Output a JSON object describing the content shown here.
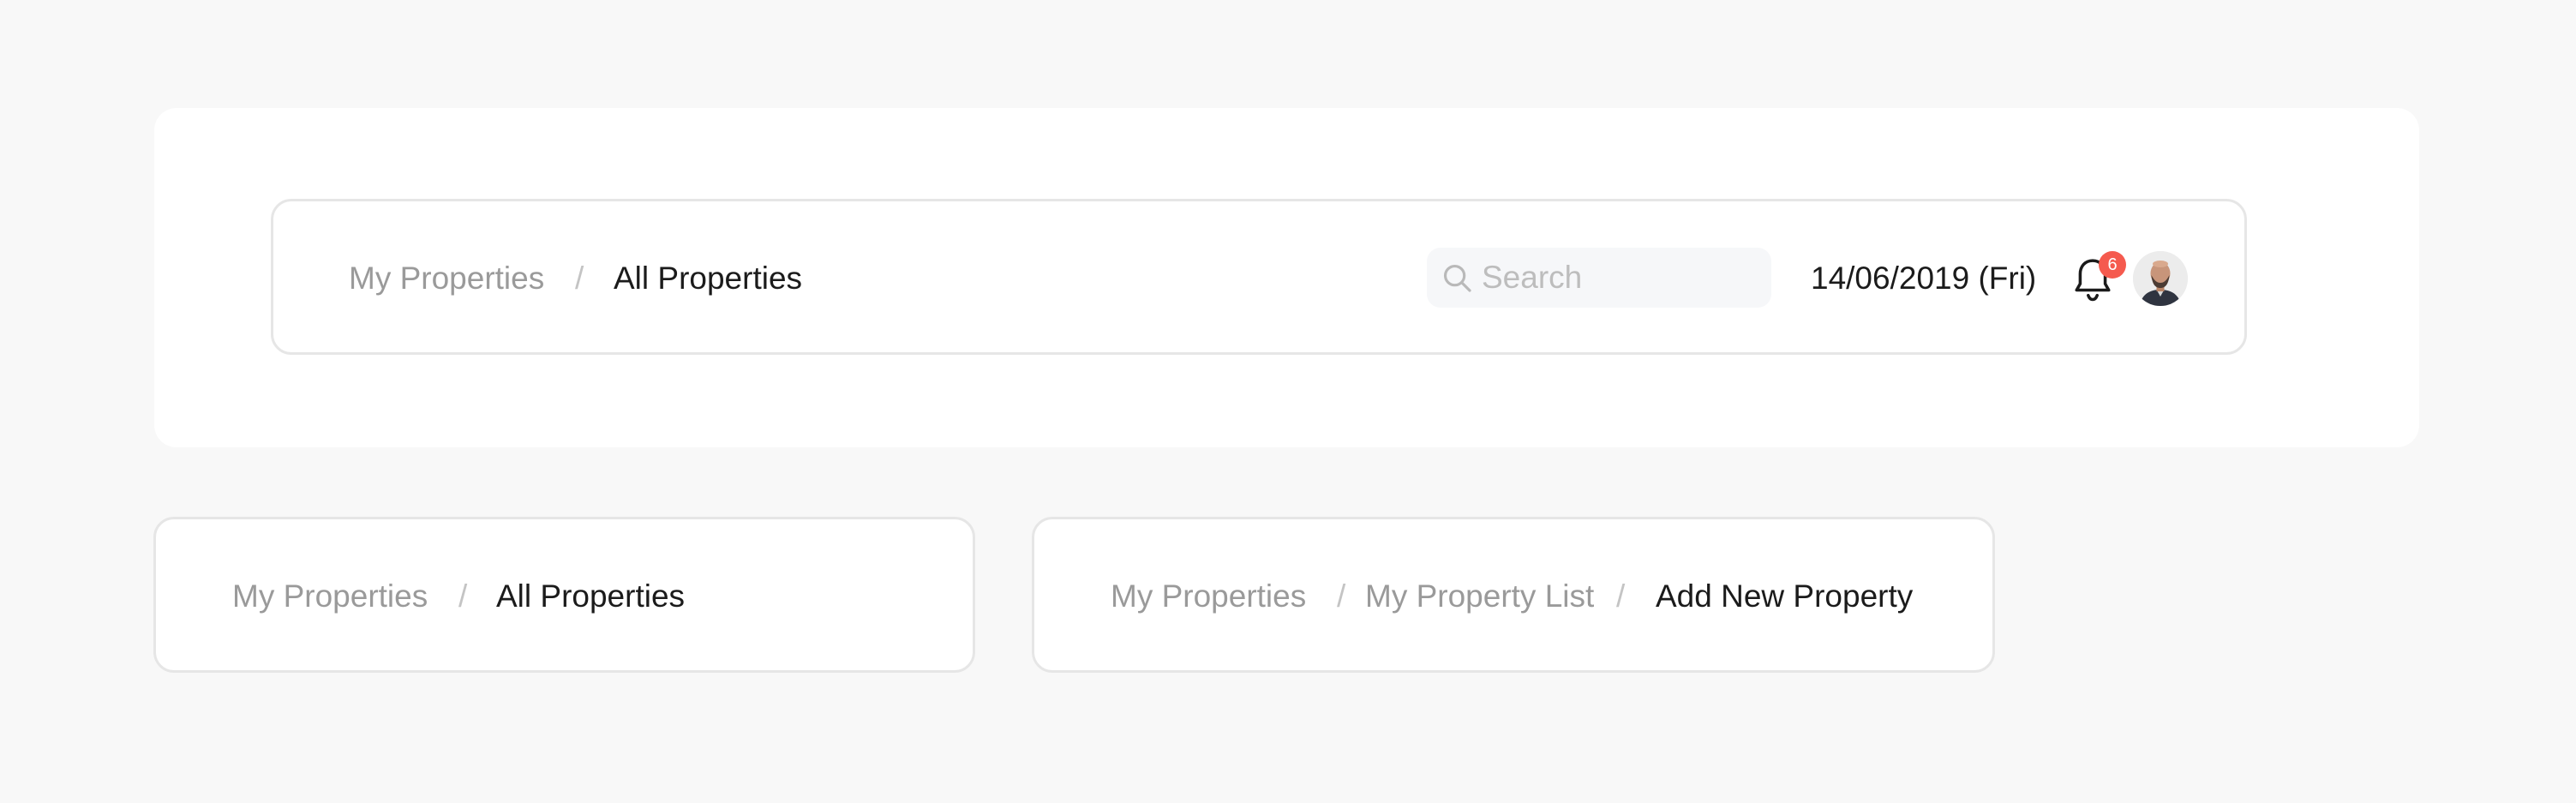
{
  "header_breadcrumb": {
    "items": [
      {
        "label": "My Properties",
        "current": false
      },
      {
        "label": "All Properties",
        "current": true
      }
    ],
    "separator": "/"
  },
  "search": {
    "placeholder": "Search",
    "value": ""
  },
  "date": "14/06/2019 (Fri)",
  "notifications": {
    "count": "6"
  },
  "breadcrumb_small": {
    "items": [
      {
        "label": "My Properties",
        "current": false
      },
      {
        "label": "All Properties",
        "current": true
      }
    ],
    "separator": "/"
  },
  "breadcrumb_medium": {
    "items": [
      {
        "label": "My Properties",
        "current": false
      },
      {
        "label": "My Property List",
        "current": false
      },
      {
        "label": "Add New Property",
        "current": true
      }
    ],
    "separator": "/"
  },
  "icons": {
    "search": "search-icon",
    "bell": "bell-icon",
    "avatar": "user-avatar"
  },
  "colors": {
    "page_background": "#f8f8f8",
    "card_border": "#e6e6e6",
    "breadcrumb_inactive": "#9a9a9a",
    "breadcrumb_active": "#1b1b1b",
    "badge": "#f55a4e"
  }
}
